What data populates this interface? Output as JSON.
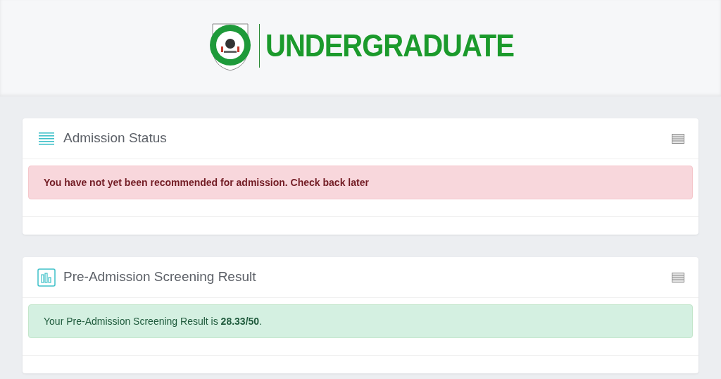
{
  "header": {
    "title": "UNDERGRADUATE"
  },
  "cards": [
    {
      "title": "Admission Status",
      "kind": "status",
      "alert": {
        "kind": "danger",
        "text": "You have not yet been recommended for admission. Check back later"
      }
    },
    {
      "title": "Pre-Admission Screening Result",
      "kind": "result",
      "alert": {
        "kind": "success",
        "text": "Your Pre-Admission Screening Result is **28.33/50**."
      }
    }
  ]
}
